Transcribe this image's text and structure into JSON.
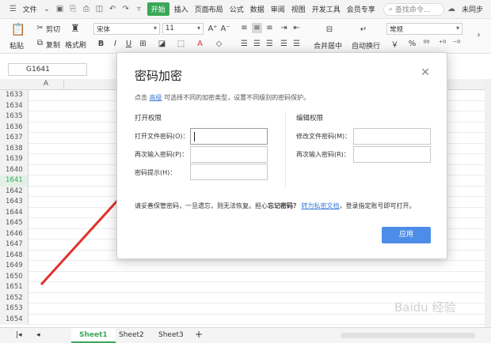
{
  "menubar": {
    "file": "文件",
    "start": "开始",
    "tabs": [
      "插入",
      "页面布局",
      "公式",
      "数据",
      "审阅",
      "视图",
      "开发工具",
      "会员专享"
    ],
    "search": "查找命令...",
    "sync": "未同步"
  },
  "ribbon": {
    "paste": "粘贴",
    "cut": "剪切",
    "copy": "复制",
    "format_painter": "格式刷",
    "font": "宋体",
    "font_size": "11",
    "bold": "B",
    "italic": "I",
    "underline": "U",
    "merge": "合并居中",
    "wrap": "自动换行",
    "number_format": "常规",
    "percent": "%",
    "currency": "￥"
  },
  "namebox": "G1641",
  "column_header": "A",
  "rows": [
    "1633",
    "1634",
    "1635",
    "1636",
    "1637",
    "1638",
    "1639",
    "1640",
    "1641",
    "1642",
    "1643",
    "1644",
    "1645",
    "1646",
    "1647",
    "1648",
    "1649",
    "1650",
    "1651",
    "1652",
    "1653",
    "1654"
  ],
  "selected_row": "1641",
  "sheets": [
    "Sheet1",
    "Sheet2",
    "Sheet3"
  ],
  "add_sheet": "+",
  "dialog": {
    "title": "密码加密",
    "tip_prefix": "点击",
    "tip_link": "高级",
    "tip_suffix": "可选择不同的加密类型，设置不同级别的密码保护。",
    "open_section": "打开权限",
    "edit_section": "编辑权限",
    "open_password_label": "打开文件密码(O)：",
    "open_password_value": "",
    "reenter_open_label": "再次输入密码(P)：",
    "reenter_open_value": "",
    "hint_label": "密码提示(H)：",
    "hint_value": "",
    "edit_password_label": "修改文件密码(M)：",
    "edit_password_value": "",
    "reenter_edit_label": "再次输入密码(R)：",
    "reenter_edit_value": "",
    "warning_prefix": "请妥善保管密码，一旦遗忘，则无法恢复。担心",
    "warning_bold": "忘记密码？",
    "warning_link": "转为私密文档",
    "warning_suffix": "，登录指定账号即可打开。",
    "apply": "应用"
  },
  "colors": {
    "accent_green": "#3aa757",
    "apply_blue": "#4d8de8",
    "arrow_red": "#e0322b"
  }
}
